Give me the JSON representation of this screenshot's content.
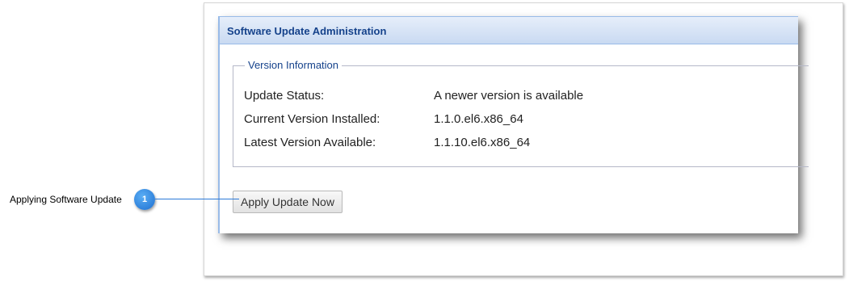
{
  "panel": {
    "title": "Software Update Administration"
  },
  "version_info": {
    "legend": "Version Information",
    "rows": [
      {
        "label": "Update Status:",
        "value": "A newer version is available"
      },
      {
        "label": "Current Version Installed:",
        "value": "1.1.0.el6.x86_64"
      },
      {
        "label": "Latest Version Available:",
        "value": "1.1.10.el6.x86_64"
      }
    ]
  },
  "actions": {
    "apply_label": "Apply Update Now"
  },
  "callout": {
    "number": "1",
    "label": "Applying Software Update"
  },
  "colors": {
    "accent": "#15428b",
    "header_border": "#99bbe8",
    "badge": "#1e6fd0"
  }
}
